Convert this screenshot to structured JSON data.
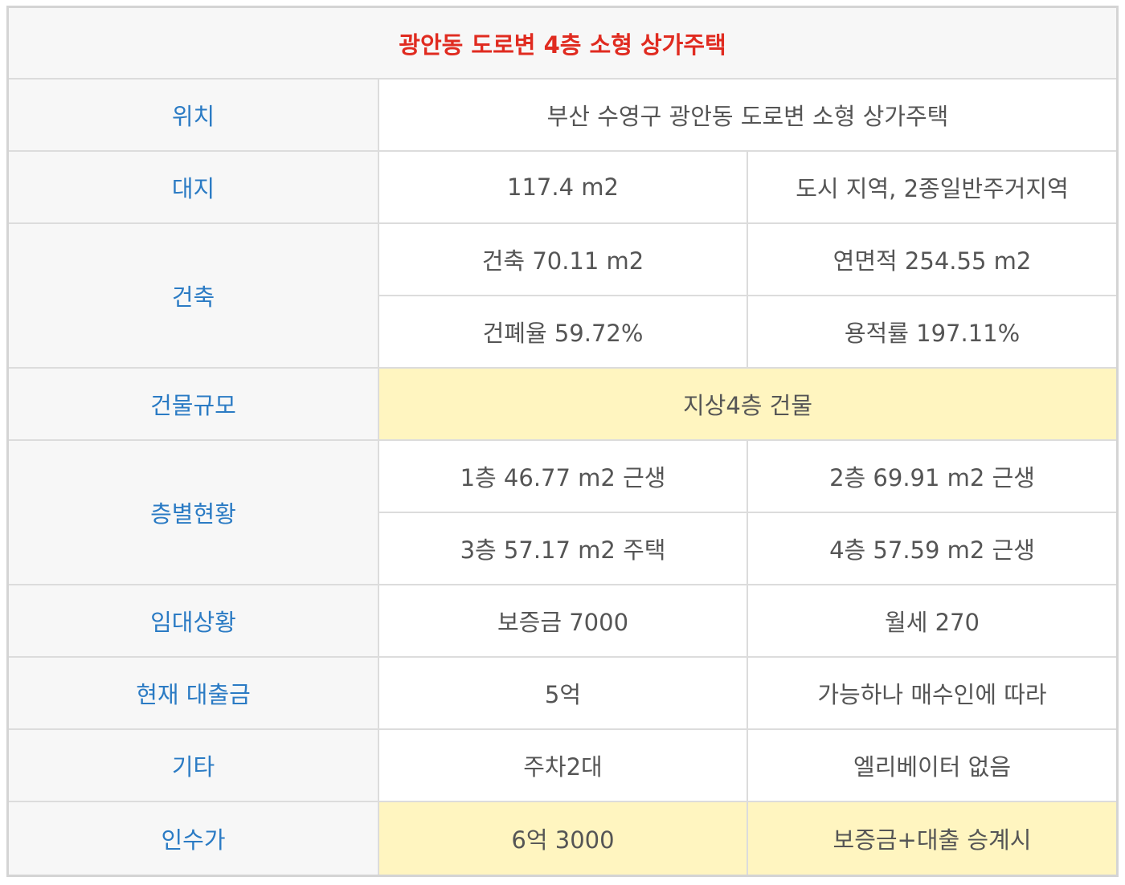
{
  "title": "광안동 도로변 4층 소형 상가주택",
  "rows": {
    "location": {
      "label": "위치",
      "value": "부산 수영구 광안동 도로변 소형 상가주택"
    },
    "land": {
      "label": "대지",
      "area": "117.4 m2",
      "zone": "도시 지역,  2종일반주거지역"
    },
    "building": {
      "label": "건축",
      "building_area": "건축 70.11 m2",
      "total_floor_area": "연면적 254.55 m2",
      "coverage_ratio": "건폐율 59.72%",
      "floor_area_ratio": "용적률 197.11%"
    },
    "scale": {
      "label": "건물규모",
      "value": "지상4층 건물"
    },
    "floors": {
      "label": "층별현황",
      "f1": "1층 46.77 m2 근생",
      "f2": "2층 69.91 m2 근생",
      "f3": "3층 57.17 m2 주택",
      "f4": "4층 57.59 m2 근생"
    },
    "lease": {
      "label": "임대상황",
      "deposit": "보증금 7000",
      "monthly_rent": "월세  270"
    },
    "loan": {
      "label": "현재 대출금",
      "amount": "5억",
      "note": "가능하나 매수인에 따라"
    },
    "etc": {
      "label": "기타",
      "parking": "주차2대",
      "elevator": "엘리베이터 없음"
    },
    "takeover": {
      "label": "인수가",
      "price": "6억 3000",
      "condition": "보증금+대출 승계시"
    }
  },
  "colors": {
    "title_text": "#e02b20",
    "label_text": "#2b7bc4",
    "body_text": "#555555",
    "label_background": "#f7f7f7",
    "highlight_background": "#fff5c0",
    "border": "#dcdcdc"
  }
}
